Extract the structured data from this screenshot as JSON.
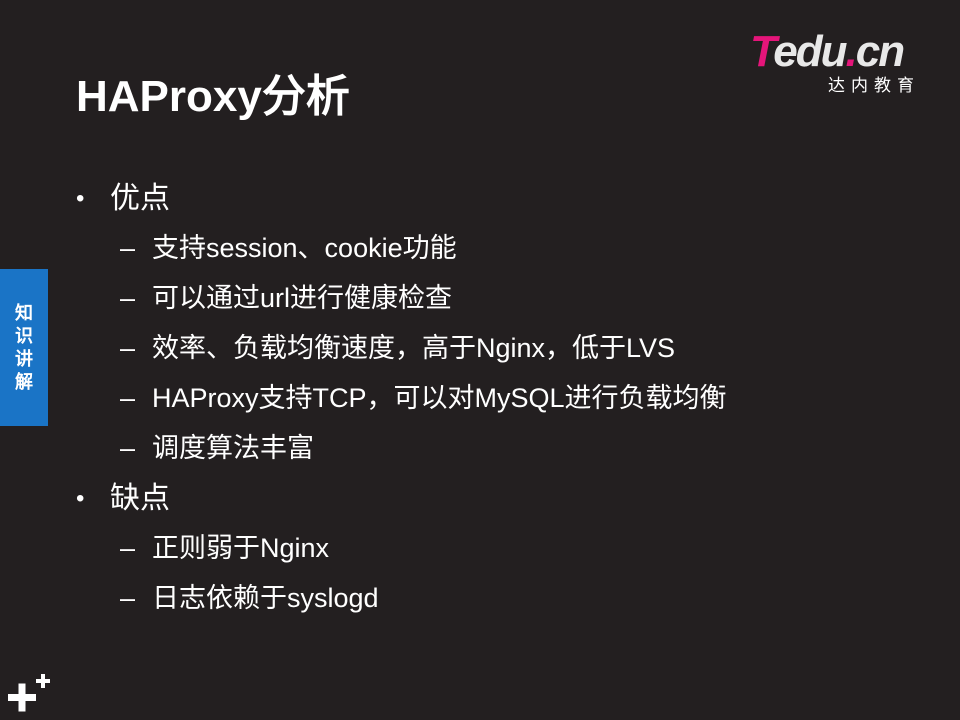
{
  "slide": {
    "title": "HAProxy分析",
    "logo": {
      "text_t": "T",
      "text_rest": "edu",
      "text_dot": ".",
      "text_cn": "cn",
      "subtitle": "达内教育"
    },
    "side_tab": "知识讲解",
    "sections": [
      {
        "label": "优点",
        "items": [
          "支持session、cookie功能",
          "可以通过url进行健康检查",
          "效率、负载均衡速度，高于Nginx，低于LVS",
          "HAProxy支持TCP，可以对MySQL进行负载均衡",
          "调度算法丰富"
        ]
      },
      {
        "label": "缺点",
        "items": [
          "正则弱于Nginx",
          "日志依赖于syslogd"
        ]
      }
    ],
    "bullet_mark": "•",
    "sub_mark": "–",
    "colors": {
      "background": "#231f20",
      "logo_accent": "#e5157a",
      "side_tab": "#1a74c6"
    },
    "icons": [
      "plus-icon"
    ]
  }
}
